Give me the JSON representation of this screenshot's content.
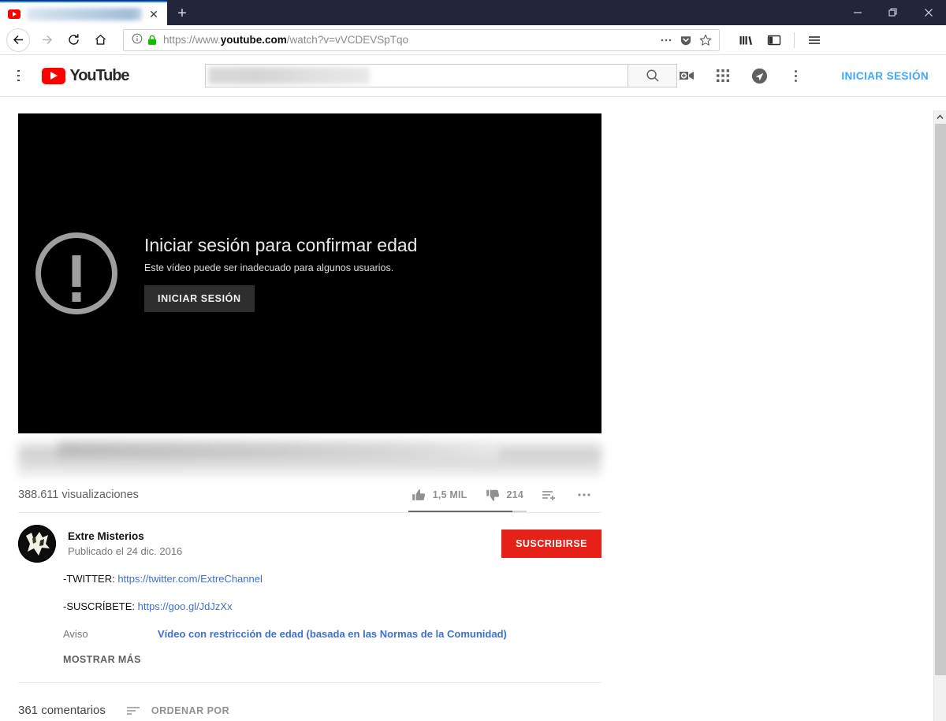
{
  "browser": {
    "tab": {
      "title_redacted": "",
      "close_label": "✕",
      "favicon": "youtube-favicon"
    },
    "newtab_label": "+",
    "window_controls": {
      "minimize": "minimize-icon",
      "restore": "restore-icon",
      "close": "close-icon"
    },
    "nav": {
      "back": "back-arrow-icon",
      "forward": "forward-arrow-icon",
      "reload": "reload-icon",
      "home": "home-icon"
    },
    "url": {
      "prefix": "https://www.",
      "host": "youtube.com",
      "path": "/watch?v=vVCDEVSpTqo",
      "full": "https://www.youtube.com/watch?v=vVCDEVSpTqo",
      "info_icon": "page-info-icon",
      "lock_icon": "secure-lock-icon"
    },
    "url_actions": {
      "more": "page-actions-icon",
      "pocket": "pocket-icon",
      "bookmark": "bookmark-star-icon"
    },
    "toolbar_right": {
      "library": "library-icon",
      "sidebar": "sidebar-icon",
      "menu": "hamburger-menu-icon"
    }
  },
  "header": {
    "menu_icon": "guide-hamburger-icon",
    "logo_text": "YouTube",
    "search_value_redacted": "",
    "search_button": "search-icon",
    "icons": [
      "create-video-icon",
      "apps-grid-icon",
      "messages-icon",
      "settings-more-icon"
    ],
    "signin_label": "INICIAR SESIÓN"
  },
  "player": {
    "title": "Iniciar sesión para confirmar edad",
    "subtitle": "Este vídeo puede ser inadecuado para algunos usuarios.",
    "button_label": "INICIAR SESIÓN",
    "warning_icon": "exclamation-circle-icon"
  },
  "video": {
    "title_redacted": "",
    "views": "388.611 visualizaciones",
    "likes": "1,5 MIL",
    "dislikes": "214",
    "like_icon": "thumbs-up-icon",
    "dislike_icon": "thumbs-down-icon",
    "save_icon": "add-to-playlist-icon",
    "more_icon": "more-actions-icon",
    "like_ratio_percent": 88
  },
  "channel": {
    "avatar": "channel-avatar",
    "name": "Extre Misterios",
    "published": "Publicado el 24 dic. 2016",
    "subscribe_label": "SUSCRIBIRSE",
    "subscribe_color": "#e62117"
  },
  "description": {
    "line1_label": "-TWITTER: ",
    "line1_link": "https://twitter.com/ExtreChannel",
    "line2_label": "-SUSCRÍBETE: ",
    "line2_link": "https://goo.gl/JdJzXx",
    "notice_label": "Aviso",
    "notice_text": "Vídeo con restricción de edad (basada en las Normas de la Comunidad)",
    "show_more": "MOSTRAR MÁS"
  },
  "comments": {
    "count_label": "361 comentarios",
    "sort_label": "ORDENAR POR",
    "sort_icon": "sort-icon"
  },
  "scrollbar": {
    "up_arrow": "ⱏ"
  }
}
